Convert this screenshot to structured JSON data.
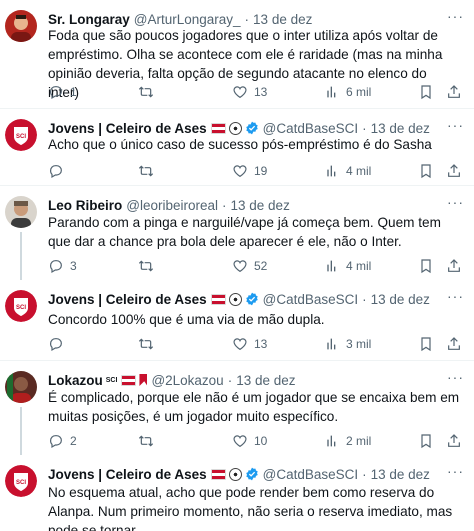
{
  "tweets": [
    {
      "name": "Sr. Longaray",
      "handle": "@ArturLongaray_",
      "time": "13 de dez",
      "text": "Foda que são poucos jogadores que o inter utiliza após voltar de empréstimo. Olha se acontece com ele é raridade (mas na minha opinião deveria, falta opção de segundo atacante no elenco do inter)",
      "replies": "1",
      "retweets": "",
      "likes": "13",
      "views": "6 mil"
    },
    {
      "name": "Jovens | Celeiro de Ases",
      "handle": "@CatdBaseSCI",
      "time": "13 de dez",
      "text": "Acho que o único caso de sucesso pós-empréstimo é do Sasha",
      "replies": "",
      "retweets": "",
      "likes": "19",
      "views": "4 mil"
    },
    {
      "name": "Leo Ribeiro",
      "handle": "@leoribeiroreal",
      "time": "13 de dez",
      "text": "Parando com a pinga e narguilé/vape já começa bem. Quem tem que dar a chance pra bola dele aparecer é ele, não o Inter.",
      "replies": "3",
      "retweets": "",
      "likes": "52",
      "views": "4 mil"
    },
    {
      "name": "Jovens | Celeiro de Ases",
      "handle": "@CatdBaseSCI",
      "time": "13 de dez",
      "text": "Concordo 100% que é uma via de mão dupla.",
      "replies": "",
      "retweets": "",
      "likes": "13",
      "views": "3 mil"
    },
    {
      "name": "Lokazou",
      "handle": "@2Lokazou",
      "time": "13 de dez",
      "name_badge": "SCI",
      "text": "É complicado, porque ele não é um jogador que se encaixa bem em muitas posições, é um jogador muito específico.",
      "replies": "2",
      "retweets": "",
      "likes": "10",
      "views": "2 mil"
    },
    {
      "name": "Jovens | Celeiro de Ases",
      "handle": "@CatdBaseSCI",
      "time": "13 de dez",
      "text": "No esquema atual, acho que pode render bem como reserva do Alanpa. Num primeiro momento, não seria o reserva imediato, mas pode se tornar."
    }
  ],
  "colors": {
    "club_red": "#c8102e",
    "verified_blue": "#1d9bf0",
    "muted": "#536471"
  },
  "icons": [
    "reply-icon",
    "retweet-icon",
    "like-icon",
    "views-icon",
    "bookmark-icon",
    "share-icon",
    "more-icon",
    "verified-icon"
  ]
}
